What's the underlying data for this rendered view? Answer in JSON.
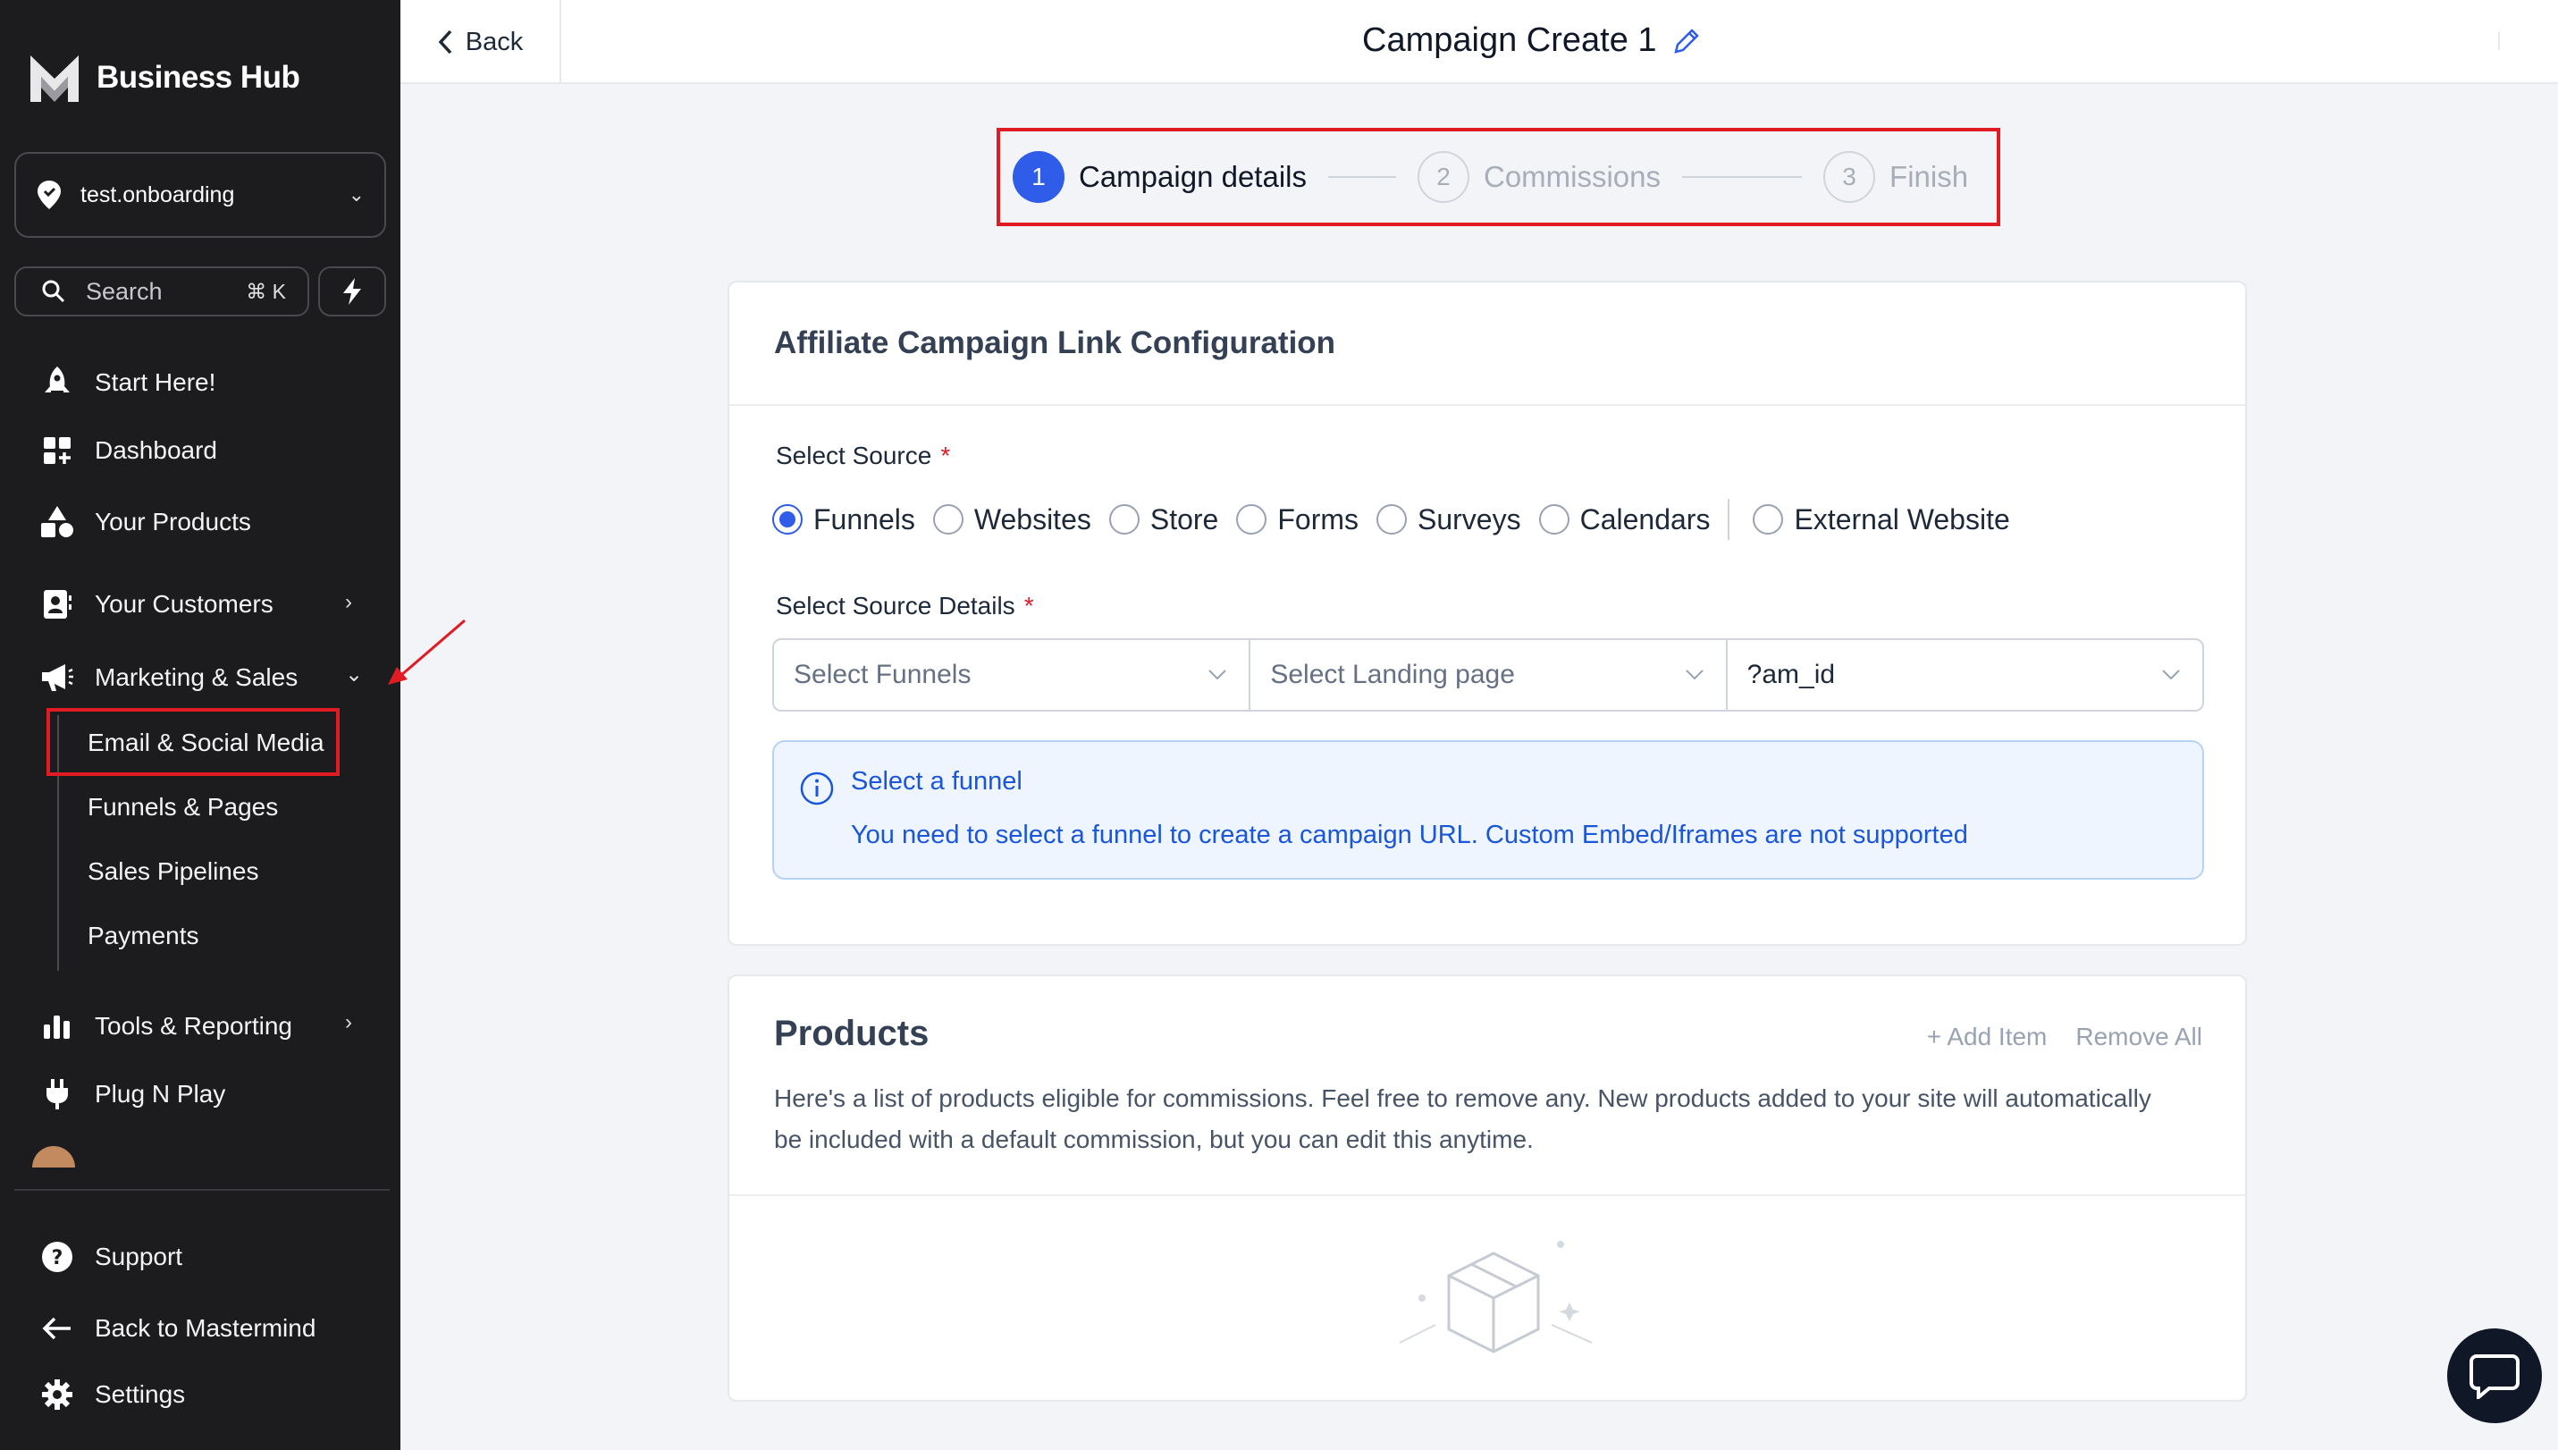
{
  "brand": {
    "name": "Business Hub"
  },
  "location": {
    "name": "test.onboarding"
  },
  "search": {
    "label": "Search",
    "shortcut": "⌘ K"
  },
  "nav": {
    "start": "Start Here!",
    "dashboard": "Dashboard",
    "products": "Your Products",
    "customers": "Your Customers",
    "marketing": "Marketing & Sales",
    "sub": [
      "Email & Social Media",
      "Funnels & Pages",
      "Sales Pipelines",
      "Payments"
    ],
    "tools": "Tools & Reporting",
    "plug": "Plug N Play",
    "support": "Support",
    "back_to": "Back to Mastermind",
    "settings": "Settings"
  },
  "topbar": {
    "back": "Back",
    "title": "Campaign Create 1"
  },
  "stepper": {
    "steps": [
      {
        "num": "1",
        "label": "Campaign details",
        "active": true
      },
      {
        "num": "2",
        "label": "Commissions",
        "active": false
      },
      {
        "num": "3",
        "label": "Finish",
        "active": false
      }
    ]
  },
  "config": {
    "title": "Affiliate Campaign Link Configuration",
    "source_label": "Select Source",
    "required_mark": "*",
    "sources": [
      "Funnels",
      "Websites",
      "Store",
      "Forms",
      "Surveys",
      "Calendars",
      "External Website"
    ],
    "selected_source": "Funnels",
    "details_label": "Select Source Details",
    "select_funnels": "Select Funnels",
    "select_landing": "Select Landing page",
    "param": "?am_id",
    "info_title": "Select a funnel",
    "info_text": "You need to select a funnel to create a campaign URL. Custom Embed/Iframes are not supported"
  },
  "products": {
    "title": "Products",
    "add_item": "+ Add Item",
    "remove_all": "Remove All",
    "description": "Here's a list of products eligible for commissions. Feel free to remove any. New products added to your site will automatically be included with a default commission, but you can edit this anytime."
  },
  "colors": {
    "accent": "#2f5ce8",
    "highlight": "#e01b24",
    "sidebar": "#1c1c1e"
  }
}
